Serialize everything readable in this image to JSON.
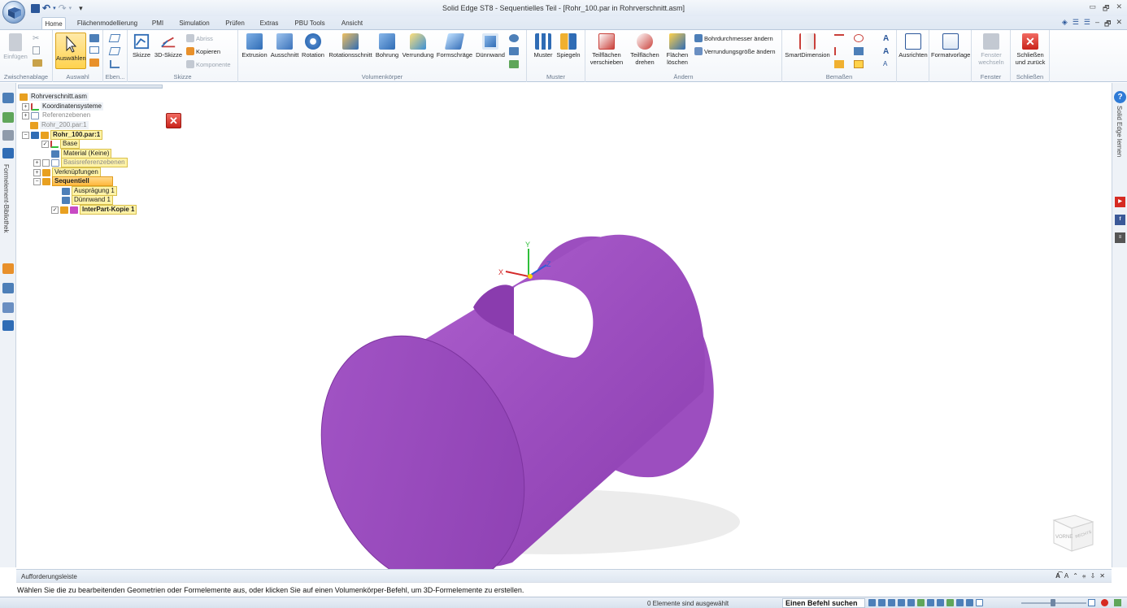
{
  "window": {
    "title": "Solid Edge ST8 - Sequentielles Teil - [Rohr_100.par in Rohrverschnitt.asm]",
    "controls": [
      "▭",
      "🗗",
      "✕"
    ]
  },
  "qat": {
    "undo_glyph": "↶",
    "redo_glyph": "↷",
    "more_glyph": "▾"
  },
  "tabs": [
    "Home",
    "Flächenmodellierung",
    "PMI",
    "Simulation",
    "Prüfen",
    "Extras",
    "PBU Tools",
    "Ansicht"
  ],
  "active_tab": "Home",
  "ribbon": {
    "zwischenablage": {
      "label": "Zwischenablage",
      "einfuegen": "Einfügen"
    },
    "auswahl": {
      "label": "Auswahl",
      "auswaehlen": "Auswählen"
    },
    "ebenen": {
      "label": "Eben..."
    },
    "skizze": {
      "label": "Skizze",
      "skizze": "Skizze",
      "skizze3d": "3D-Skizze",
      "abriss": "Abriss",
      "kopieren": "Kopieren",
      "komponente": "Komponente"
    },
    "volumen": {
      "label": "Volumenkörper",
      "extrusion": "Extrusion",
      "ausschnitt": "Ausschnitt",
      "rotation": "Rotation",
      "rotationsschnitt": "Rotationsschnitt",
      "bohrung": "Bohrung",
      "verrundung": "Verrundung",
      "formschraege": "Formschräge",
      "duennwand": "Dünnwand"
    },
    "muster": {
      "label": "Muster",
      "muster": "Muster",
      "spiegeln": "Spiegeln"
    },
    "aendern": {
      "label": "Ändern",
      "teilflaechen_verschieben": "Teilflächen verschieben",
      "teilflaechen_drehen": "Teilflächen drehen",
      "flaechen_loeschen": "Flächen löschen",
      "bohrdurchmesser": "Bohrdurchmesser ändern",
      "verrundungsgroesse": "Verrundungsgröße ändern"
    },
    "bemassen": {
      "label": "Bemaßen",
      "smartdimension": "SmartDimension"
    },
    "ausrichten": {
      "label": "Ausrichten"
    },
    "formatvorlage": {
      "label": "Formatvorlage"
    },
    "fenster": {
      "label": "Fenster",
      "fenster_wechseln": "Fenster wechseln"
    },
    "schliessen": {
      "label": "Schließen",
      "schliessen_zurueck": "Schließen und zurück"
    }
  },
  "left_panel": {
    "vertical_label": "Formelement-Bibliothek"
  },
  "right_panel": {
    "vertical_label": "Solid Edge lernen",
    "help": "?"
  },
  "tree": {
    "root": "Rohrverschnitt.asm",
    "koordinatensysteme": "Koordinatensysteme",
    "referenzebenen": "Referenzebenen",
    "rohr200": "Rohr_200.par:1",
    "rohr100": "Rohr_100.par:1",
    "base": "Base",
    "material": "Material (Keine)",
    "basisreferenzebenen": "Basisreferenzebenen",
    "verknuepfungen": "Verknüpfungen",
    "sequentiell": "Sequentiell",
    "auspraegung": "Ausprägung 1",
    "duennwand": "Dünnwand 1",
    "interpart": "InterPart-Kopie 1"
  },
  "viewport": {
    "triad": {
      "x": "X",
      "y": "Y",
      "z": "Z"
    },
    "viewcube": {
      "front": "VORNE",
      "right": "RECHTS"
    }
  },
  "prompt": {
    "title": "Aufforderungsleiste",
    "text": "Wählen Sie die zu bearbeitenden Geometrien oder Formelemente aus, oder klicken Sie auf einen Volumenkörper-Befehl, um 3D-Formelemente zu erstellen.",
    "controls": [
      "A͡",
      "A",
      "⌃",
      "⩷",
      "⇩",
      "✕"
    ]
  },
  "status": {
    "selection": "0 Elemente sind ausgewählt",
    "command_search": "Einen Befehl suchen"
  },
  "colors": {
    "part": "#a352c4",
    "accent": "#2b579a",
    "select": "#ffd34f"
  }
}
